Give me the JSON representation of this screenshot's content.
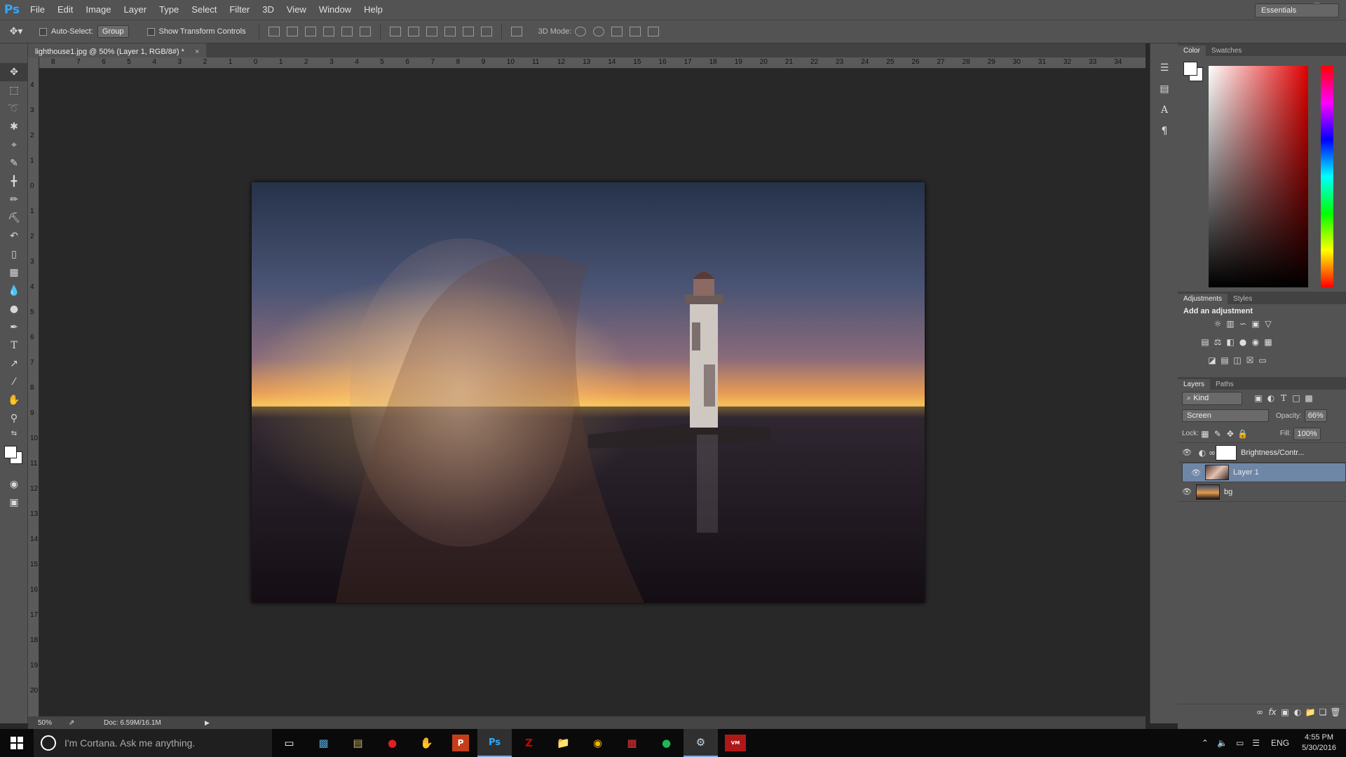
{
  "app": {
    "logo": "Ps"
  },
  "menu": [
    "File",
    "Edit",
    "Image",
    "Layer",
    "Type",
    "Select",
    "Filter",
    "3D",
    "View",
    "Window",
    "Help"
  ],
  "options": {
    "auto_select_label": "Auto-Select:",
    "auto_select_value": "Group",
    "show_transform_label": "Show Transform Controls",
    "mode_3d_label": "3D Mode:",
    "workspace": "Essentials"
  },
  "document": {
    "tab_title": "lighthouse1.jpg @ 50% (Layer 1, RGB/8#) *",
    "close": "×"
  },
  "ruler": {
    "top": [
      "8",
      "7",
      "6",
      "5",
      "4",
      "3",
      "2",
      "1",
      "0",
      "1",
      "2",
      "3",
      "4",
      "5",
      "6",
      "7",
      "8",
      "9",
      "10",
      "11",
      "12",
      "13",
      "14",
      "15",
      "16",
      "17",
      "18",
      "19",
      "20",
      "21",
      "22",
      "23",
      "24",
      "25",
      "26",
      "27",
      "28",
      "29",
      "30",
      "31",
      "32",
      "33",
      "34"
    ],
    "left": [
      "4",
      "3",
      "2",
      "1",
      "0",
      "1",
      "2",
      "3",
      "4",
      "5",
      "6",
      "7",
      "8",
      "9",
      "10",
      "11",
      "12",
      "13",
      "14",
      "15",
      "16",
      "17",
      "18",
      "19",
      "20"
    ]
  },
  "status": {
    "zoom": "50%",
    "doc": "Doc: 6.59M/16.1M"
  },
  "color_panel": {
    "tabs": [
      "Color",
      "Swatches"
    ]
  },
  "adjustments_panel": {
    "tabs": [
      "Adjustments",
      "Styles"
    ],
    "heading": "Add an adjustment"
  },
  "layers_panel": {
    "tabs": [
      "Layers",
      "Paths"
    ],
    "filter": "Kind",
    "blend_mode": "Screen",
    "opacity_label": "Opacity:",
    "opacity_value": "66%",
    "lock_label": "Lock:",
    "fill_label": "Fill:",
    "fill_value": "100%",
    "layers": [
      {
        "name": "Brightness/Contr..."
      },
      {
        "name": "Layer 1"
      },
      {
        "name": "bg"
      }
    ]
  },
  "taskbar": {
    "cortana": "I'm Cortana. Ask me anything.",
    "lang": "ENG",
    "time": "4:55 PM",
    "date": "5/30/2016"
  },
  "colors": {
    "accent": "#31a8ff",
    "selected_layer": "#6f87a6"
  }
}
